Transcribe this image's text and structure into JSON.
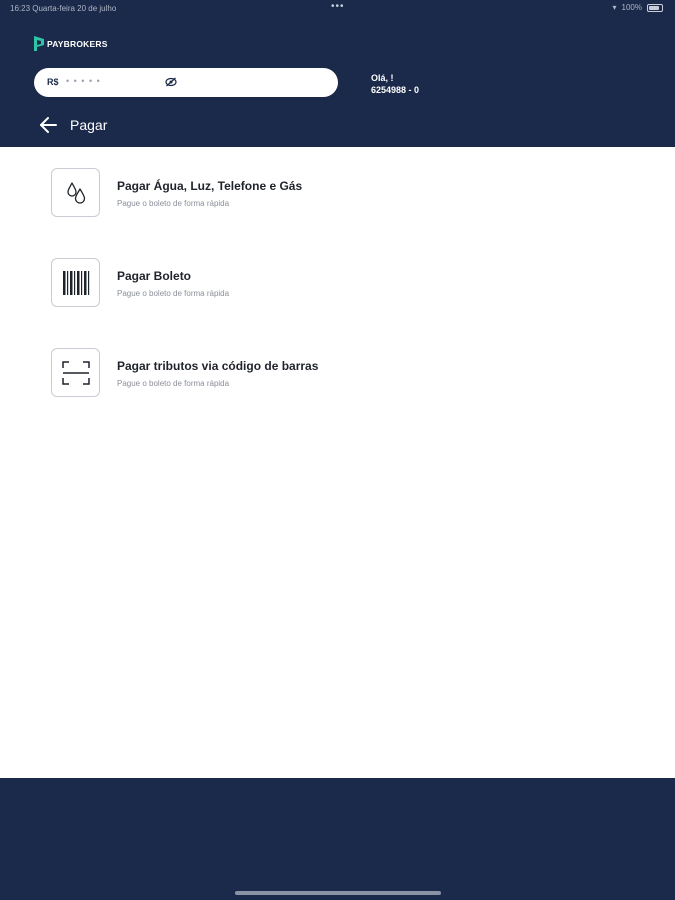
{
  "status_bar": {
    "time_date": "16:23   Quarta-feira 20 de julho",
    "dots": "•••",
    "battery": "100%"
  },
  "brand": {
    "name": "PAYBROKERS",
    "primary_color": "#1b2a4a",
    "accent_color": "#2ec4a6"
  },
  "balance": {
    "currency": "R$",
    "hidden_value": "• • • • •",
    "toggle_icon": "eye-icon"
  },
  "user": {
    "greeting": "Olá, !",
    "account": "6254988 - 0"
  },
  "nav": {
    "back_icon": "arrow-left-icon",
    "title": "Pagar"
  },
  "options": [
    {
      "icon": "water-drops-icon",
      "title": "Pagar Água, Luz, Telefone e Gás",
      "subtitle": "Pague o boleto de forma rápida"
    },
    {
      "icon": "barcode-icon",
      "title": "Pagar Boleto",
      "subtitle": "Pague o boleto de forma rápida"
    },
    {
      "icon": "scan-frame-icon",
      "title": "Pagar tributos via código de barras",
      "subtitle": "Pague o boleto de forma rápida"
    }
  ]
}
